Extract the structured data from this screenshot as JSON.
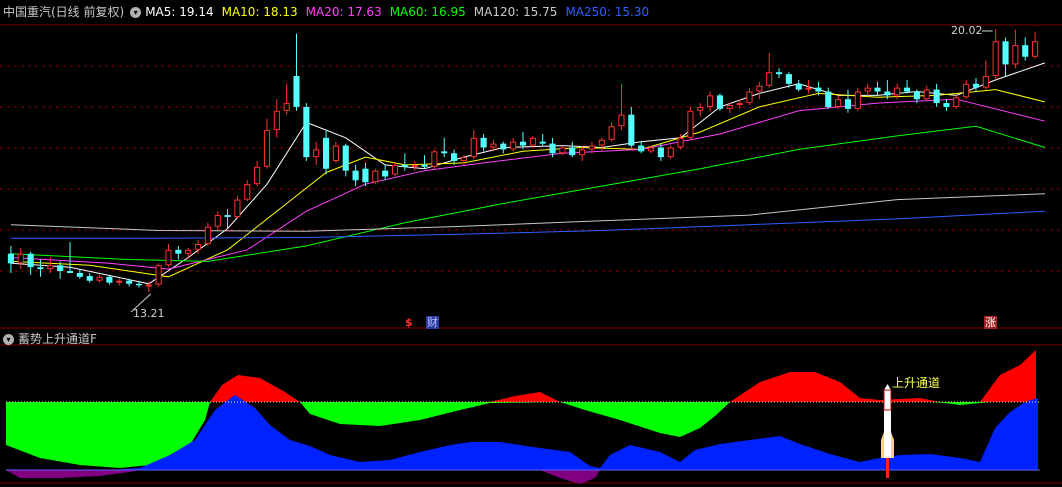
{
  "main_panel": {
    "title": "中国重汽(日线 前复权)",
    "ma_labels": [
      {
        "text": "MA5: 19.14",
        "color": "#ffffff"
      },
      {
        "text": "MA10: 18.13",
        "color": "#ffff00"
      },
      {
        "text": "MA20: 17.63",
        "color": "#ff40ff"
      },
      {
        "text": "MA60: 16.95",
        "color": "#00ff00"
      },
      {
        "text": "MA120: 15.75",
        "color": "#c8c8c8"
      },
      {
        "text": "MA250: 15.30",
        "color": "#2f5fff"
      }
    ],
    "high_label": "20.02",
    "low_label": "13.21",
    "markers": {
      "s_mark": "$",
      "cai_mark": "财",
      "zhang_mark": "涨"
    }
  },
  "sub_panel": {
    "title": "蓄势上升通道F",
    "annotation": "上升通道"
  },
  "colors": {
    "up": "#ff3030",
    "down": "#54ffff",
    "grid": "#800000",
    "green_area": "#00ff00",
    "red_area": "#ff0000",
    "blue_area": "#0022ff",
    "purple_area": "#800080"
  },
  "chart_data": {
    "type": "candlestick",
    "ohlc": [
      [
        14.2,
        14.4,
        13.7,
        13.95
      ],
      [
        13.95,
        14.35,
        13.8,
        14.2
      ],
      [
        14.2,
        14.25,
        13.65,
        13.85
      ],
      [
        13.85,
        14.05,
        13.6,
        13.8
      ],
      [
        13.8,
        14.1,
        13.7,
        13.9
      ],
      [
        13.9,
        14.0,
        13.55,
        13.75
      ],
      [
        13.75,
        14.5,
        13.7,
        13.7
      ],
      [
        13.7,
        13.8,
        13.55,
        13.6
      ],
      [
        13.62,
        13.7,
        13.45,
        13.5
      ],
      [
        13.5,
        13.65,
        13.45,
        13.6
      ],
      [
        13.6,
        13.62,
        13.4,
        13.45
      ],
      [
        13.45,
        13.55,
        13.38,
        13.5
      ],
      [
        13.5,
        13.55,
        13.35,
        13.42
      ],
      [
        13.42,
        13.5,
        13.32,
        13.38
      ],
      [
        13.38,
        13.48,
        13.21,
        13.4
      ],
      [
        13.4,
        13.95,
        13.35,
        13.9
      ],
      [
        13.9,
        14.45,
        13.85,
        14.3
      ],
      [
        14.3,
        14.4,
        14.05,
        14.2
      ],
      [
        14.2,
        14.35,
        14.05,
        14.3
      ],
      [
        14.3,
        14.55,
        14.2,
        14.45
      ],
      [
        14.45,
        15.0,
        14.4,
        14.9
      ],
      [
        14.9,
        15.3,
        14.8,
        15.2
      ],
      [
        15.2,
        15.35,
        14.85,
        15.15
      ],
      [
        15.15,
        15.7,
        15.1,
        15.6
      ],
      [
        15.6,
        16.1,
        15.55,
        16.0
      ],
      [
        16.0,
        16.6,
        15.95,
        16.45
      ],
      [
        16.45,
        17.7,
        16.4,
        17.4
      ],
      [
        17.4,
        18.2,
        17.2,
        17.9
      ],
      [
        17.9,
        18.6,
        17.8,
        18.1
      ],
      [
        18.8,
        19.9,
        17.9,
        18.0
      ],
      [
        18.0,
        18.1,
        16.6,
        16.7
      ],
      [
        16.7,
        17.1,
        16.5,
        16.9
      ],
      [
        17.2,
        17.4,
        16.25,
        16.4
      ],
      [
        16.6,
        17.1,
        16.55,
        17.0
      ],
      [
        17.0,
        17.05,
        16.2,
        16.35
      ],
      [
        16.35,
        16.5,
        15.95,
        16.1
      ],
      [
        16.4,
        16.55,
        15.95,
        16.05
      ],
      [
        16.05,
        16.4,
        16.0,
        16.35
      ],
      [
        16.35,
        16.5,
        16.1,
        16.2
      ],
      [
        16.25,
        16.55,
        16.2,
        16.5
      ],
      [
        16.5,
        16.8,
        16.35,
        16.45
      ],
      [
        16.45,
        16.6,
        16.35,
        16.5
      ],
      [
        16.5,
        16.75,
        16.4,
        16.45
      ],
      [
        16.45,
        16.9,
        16.4,
        16.85
      ],
      [
        16.85,
        17.2,
        16.7,
        16.8
      ],
      [
        16.8,
        16.9,
        16.5,
        16.6
      ],
      [
        16.6,
        16.75,
        16.5,
        16.7
      ],
      [
        16.7,
        17.4,
        16.65,
        17.2
      ],
      [
        17.2,
        17.3,
        16.85,
        16.95
      ],
      [
        16.95,
        17.15,
        16.85,
        17.05
      ],
      [
        17.05,
        17.1,
        16.8,
        16.9
      ],
      [
        16.9,
        17.2,
        16.85,
        17.1
      ],
      [
        17.1,
        17.35,
        16.9,
        17.0
      ],
      [
        17.0,
        17.25,
        16.95,
        17.2
      ],
      [
        17.1,
        17.3,
        17.0,
        17.05
      ],
      [
        17.05,
        17.2,
        16.7,
        16.8
      ],
      [
        16.8,
        17.0,
        16.75,
        16.95
      ],
      [
        16.95,
        17.1,
        16.7,
        16.75
      ],
      [
        16.75,
        17.0,
        16.6,
        16.9
      ],
      [
        16.9,
        17.1,
        16.8,
        17.0
      ],
      [
        17.0,
        17.2,
        16.85,
        17.15
      ],
      [
        17.15,
        17.6,
        17.1,
        17.5
      ],
      [
        17.5,
        18.6,
        17.4,
        17.8
      ],
      [
        17.8,
        18.0,
        16.95,
        17.0
      ],
      [
        17.0,
        17.1,
        16.8,
        16.85
      ],
      [
        16.85,
        17.0,
        16.8,
        16.95
      ],
      [
        16.95,
        17.05,
        16.6,
        16.7
      ],
      [
        16.7,
        17.0,
        16.65,
        16.95
      ],
      [
        16.95,
        17.3,
        16.9,
        17.2
      ],
      [
        17.2,
        18.0,
        17.15,
        17.9
      ],
      [
        17.9,
        18.1,
        17.75,
        18.0
      ],
      [
        18.0,
        18.4,
        17.9,
        18.3
      ],
      [
        18.3,
        18.35,
        17.9,
        17.95
      ],
      [
        17.95,
        18.1,
        17.85,
        18.05
      ],
      [
        18.05,
        18.2,
        17.95,
        18.1
      ],
      [
        18.1,
        18.5,
        18.05,
        18.4
      ],
      [
        18.4,
        18.65,
        18.2,
        18.55
      ],
      [
        18.55,
        19.4,
        18.5,
        18.9
      ],
      [
        18.9,
        19.0,
        18.75,
        18.85
      ],
      [
        18.85,
        18.9,
        18.5,
        18.6
      ],
      [
        18.6,
        18.7,
        18.4,
        18.45
      ],
      [
        18.45,
        18.7,
        18.35,
        18.5
      ],
      [
        18.5,
        18.65,
        18.3,
        18.4
      ],
      [
        18.4,
        18.5,
        17.95,
        18.0
      ],
      [
        18.0,
        18.3,
        17.95,
        18.2
      ],
      [
        18.2,
        18.45,
        17.85,
        17.95
      ],
      [
        17.95,
        18.5,
        17.9,
        18.4
      ],
      [
        18.4,
        18.6,
        18.3,
        18.5
      ],
      [
        18.5,
        18.65,
        18.3,
        18.4
      ],
      [
        18.4,
        18.7,
        18.2,
        18.3
      ],
      [
        18.3,
        18.6,
        18.2,
        18.5
      ],
      [
        18.5,
        18.7,
        18.35,
        18.4
      ],
      [
        18.4,
        18.45,
        18.1,
        18.2
      ],
      [
        18.2,
        18.55,
        18.15,
        18.45
      ],
      [
        18.45,
        18.6,
        18.0,
        18.1
      ],
      [
        18.1,
        18.2,
        17.9,
        18.0
      ],
      [
        18.0,
        18.3,
        17.95,
        18.25
      ],
      [
        18.25,
        18.7,
        18.2,
        18.6
      ],
      [
        18.6,
        18.75,
        18.4,
        18.5
      ],
      [
        18.5,
        19.2,
        18.45,
        18.8
      ],
      [
        18.8,
        20.02,
        18.7,
        19.7
      ],
      [
        19.7,
        19.8,
        18.8,
        19.1
      ],
      [
        19.1,
        20.0,
        19.0,
        19.6
      ],
      [
        19.6,
        19.8,
        19.2,
        19.3
      ],
      [
        19.3,
        19.95,
        19.25,
        19.7
      ]
    ],
    "ma_series": [
      {
        "name": "MA5",
        "color": "#ffffff",
        "values": [
          [
            0,
            13.95
          ],
          [
            6,
            13.85
          ],
          [
            14,
            13.42
          ],
          [
            18,
            14.1
          ],
          [
            22,
            14.85
          ],
          [
            26,
            16.0
          ],
          [
            30,
            17.6
          ],
          [
            34,
            17.2
          ],
          [
            38,
            16.5
          ],
          [
            42,
            16.4
          ],
          [
            46,
            16.7
          ],
          [
            50,
            16.95
          ],
          [
            56,
            17.0
          ],
          [
            60,
            16.95
          ],
          [
            64,
            17.1
          ],
          [
            68,
            17.2
          ],
          [
            72,
            18.0
          ],
          [
            76,
            18.35
          ],
          [
            80,
            18.6
          ],
          [
            84,
            18.3
          ],
          [
            88,
            18.3
          ],
          [
            92,
            18.4
          ],
          [
            96,
            18.3
          ],
          [
            100,
            18.7
          ],
          [
            105,
            19.14
          ]
        ]
      },
      {
        "name": "MA10",
        "color": "#ffff00",
        "values": [
          [
            0,
            14.0
          ],
          [
            8,
            13.9
          ],
          [
            16,
            13.6
          ],
          [
            22,
            14.3
          ],
          [
            28,
            15.5
          ],
          [
            32,
            16.3
          ],
          [
            36,
            16.7
          ],
          [
            40,
            16.5
          ],
          [
            46,
            16.55
          ],
          [
            52,
            16.85
          ],
          [
            58,
            16.95
          ],
          [
            64,
            16.9
          ],
          [
            70,
            17.35
          ],
          [
            76,
            18.0
          ],
          [
            82,
            18.35
          ],
          [
            88,
            18.25
          ],
          [
            94,
            18.3
          ],
          [
            100,
            18.45
          ],
          [
            105,
            18.13
          ]
        ]
      },
      {
        "name": "MA20",
        "color": "#ff40ff",
        "values": [
          [
            0,
            14.1
          ],
          [
            10,
            13.95
          ],
          [
            16,
            13.8
          ],
          [
            24,
            14.3
          ],
          [
            30,
            15.3
          ],
          [
            36,
            16.0
          ],
          [
            42,
            16.35
          ],
          [
            48,
            16.55
          ],
          [
            56,
            16.8
          ],
          [
            64,
            16.9
          ],
          [
            72,
            17.3
          ],
          [
            80,
            17.9
          ],
          [
            88,
            18.1
          ],
          [
            96,
            18.2
          ],
          [
            105,
            17.63
          ]
        ]
      },
      {
        "name": "MA60",
        "color": "#00ff00",
        "values": [
          [
            0,
            14.2
          ],
          [
            12,
            14.05
          ],
          [
            20,
            14.0
          ],
          [
            30,
            14.4
          ],
          [
            40,
            15.0
          ],
          [
            50,
            15.5
          ],
          [
            60,
            15.95
          ],
          [
            70,
            16.4
          ],
          [
            80,
            16.9
          ],
          [
            90,
            17.25
          ],
          [
            98,
            17.5
          ],
          [
            105,
            16.95
          ]
        ]
      },
      {
        "name": "MA120",
        "color": "#c8c8c8",
        "values": [
          [
            0,
            14.95
          ],
          [
            15,
            14.8
          ],
          [
            30,
            14.78
          ],
          [
            45,
            14.9
          ],
          [
            60,
            15.05
          ],
          [
            75,
            15.2
          ],
          [
            90,
            15.6
          ],
          [
            105,
            15.75
          ]
        ]
      },
      {
        "name": "MA250",
        "color": "#2f5fff",
        "values": [
          [
            0,
            14.6
          ],
          [
            15,
            14.6
          ],
          [
            30,
            14.62
          ],
          [
            45,
            14.7
          ],
          [
            60,
            14.8
          ],
          [
            75,
            14.95
          ],
          [
            90,
            15.1
          ],
          [
            105,
            15.3
          ]
        ]
      }
    ]
  }
}
